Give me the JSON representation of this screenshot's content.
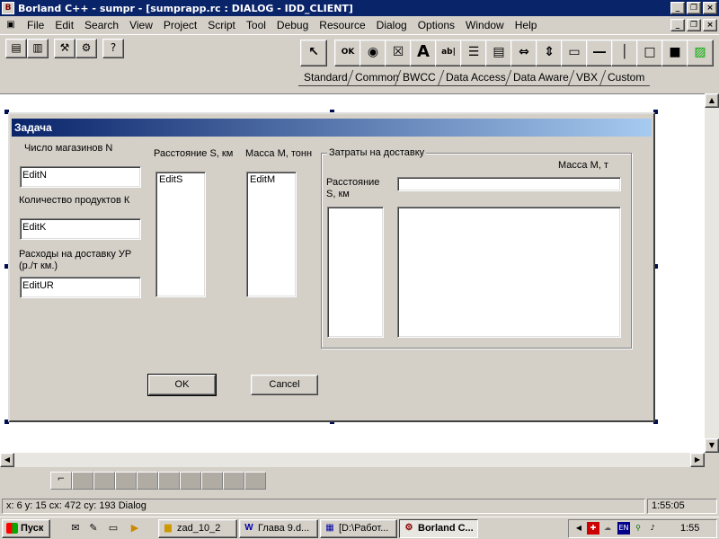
{
  "window": {
    "title": "Borland C++ - sumpr - [sumprapp.rc : DIALOG - IDD_CLIENT]",
    "minimize": "_",
    "maximize": "❐",
    "close": "×"
  },
  "menu": {
    "items": [
      "File",
      "Edit",
      "Search",
      "View",
      "Project",
      "Script",
      "Tool",
      "Debug",
      "Resource",
      "Dialog",
      "Options",
      "Window",
      "Help"
    ]
  },
  "toolbar": {
    "ok_label": "OK",
    "text_label": "A",
    "edit_label": "ab|"
  },
  "palette_tabs": [
    "Standard",
    "Common",
    "BWCC",
    "Data Access",
    "Data Aware",
    "VBX",
    "Custom"
  ],
  "dialog": {
    "caption": "Задача",
    "label_stores": "Число магазинов N",
    "edit_n": "EditN",
    "label_products": "Количество продуктов К",
    "edit_k": "EditK",
    "label_costs": "Расходы на доставку УР (р./т км.)",
    "edit_ur": "EditUR",
    "label_distance": "Расстояние S, км",
    "list_s": "EditS",
    "label_mass": "Масса М, тонн",
    "list_m": "EditM",
    "group_title": "Затраты на доставку",
    "group_mass_label": "Масса М, т",
    "group_distance_label": "Расстояние S, км",
    "ok_button": "OK",
    "cancel_button": "Cancel"
  },
  "status": {
    "text": "x: 6  y: 15  cx: 472  cy: 193   Dialog",
    "time": "1:55:05"
  },
  "taskbar": {
    "start": "Пуск",
    "tasks": [
      "zad_10_2",
      "Глава 9.d...",
      "[D:\\Работ...",
      "Borland C..."
    ],
    "lang": "EN",
    "clock": "1:55"
  }
}
